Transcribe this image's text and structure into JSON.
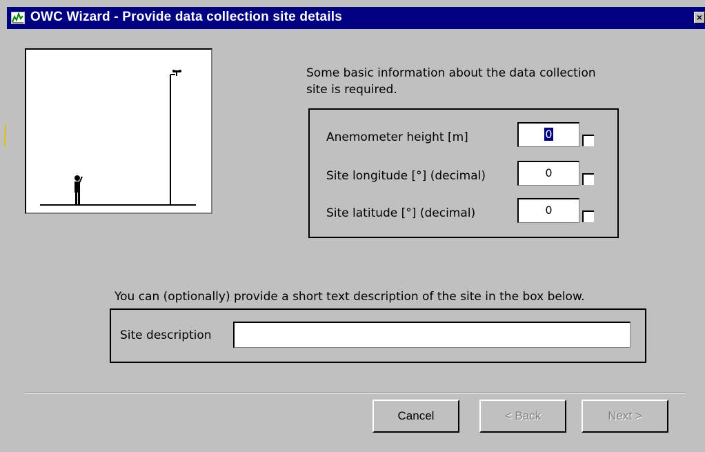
{
  "window": {
    "title": "OWC Wizard - Provide data collection site details",
    "icon": "chart-icon",
    "close_label": "×"
  },
  "intro_text": "Some basic information about the data collection site is required.",
  "site_fields": {
    "anemometer_height": {
      "label": "Anemometer height [m]",
      "value": "0"
    },
    "longitude": {
      "label": "Site longitude [°] (decimal)",
      "value": "0"
    },
    "latitude": {
      "label": "Site latitude [°] (decimal)",
      "value": "0"
    }
  },
  "description_prompt": "You can (optionally) provide a short text description of the site in the box below.",
  "description": {
    "label": "Site description",
    "value": ""
  },
  "buttons": {
    "cancel": "Cancel",
    "back": "< Back",
    "next": "Next >"
  },
  "colors": {
    "titlebar": "#000080",
    "dialog": "#c0c0c0",
    "selection": "#000080"
  }
}
